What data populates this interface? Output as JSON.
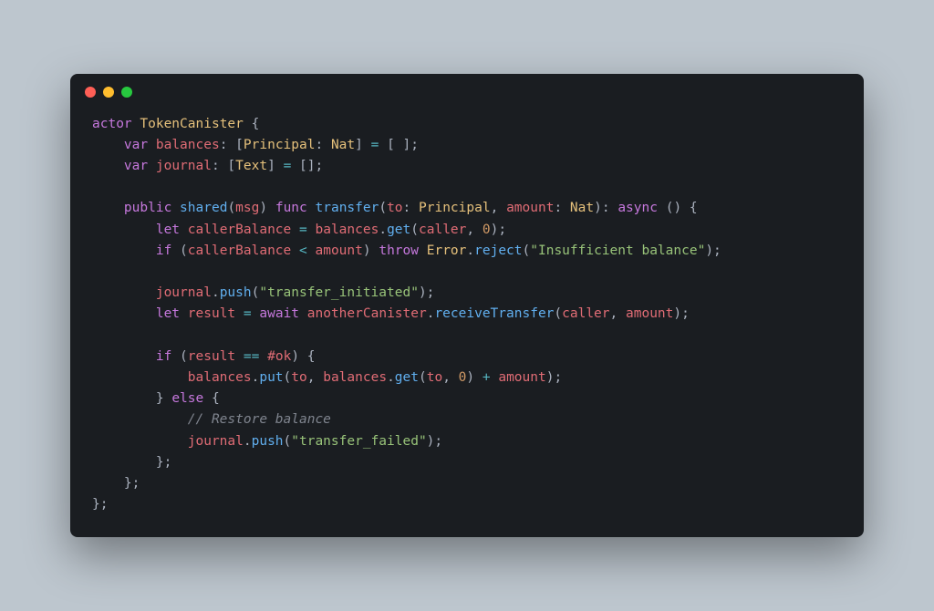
{
  "code": {
    "l1": {
      "kw1": "actor",
      "type1": "TokenCanister",
      "p1": " {"
    },
    "l2": {
      "kw1": "var",
      "id1": "balances",
      "p1": ": [",
      "type1": "Principal",
      "p2": ": ",
      "type2": "Nat",
      "p3": "] ",
      "op1": "=",
      "p4": " [ ];"
    },
    "l3": {
      "kw1": "var",
      "id1": "journal",
      "p1": ": [",
      "type1": "Text",
      "p2": "] ",
      "op1": "=",
      "p3": " [];"
    },
    "l4": {
      "blank": ""
    },
    "l5": {
      "kw1": "public",
      "fn1": "shared",
      "p1": "(",
      "id1": "msg",
      "p2": ") ",
      "kw2": "func",
      "fn2": "transfer",
      "p3": "(",
      "id2": "to",
      "p4": ": ",
      "type1": "Principal",
      "p5": ", ",
      "id3": "amount",
      "p6": ": ",
      "type2": "Nat",
      "p7": "): ",
      "kw3": "async",
      "p8": " () {"
    },
    "l6": {
      "kw1": "let",
      "id1": "callerBalance",
      "op1": "=",
      "id2": "balances",
      "p1": ".",
      "fn1": "get",
      "p2": "(",
      "id3": "caller",
      "p3": ", ",
      "num1": "0",
      "p4": ");"
    },
    "l7": {
      "kw1": "if",
      "p1": " (",
      "id1": "callerBalance",
      "op1": "<",
      "id2": "amount",
      "p2": ") ",
      "kw2": "throw",
      "type1": "Error",
      "p3": ".",
      "fn1": "reject",
      "p4": "(",
      "str1": "\"Insufficient balance\"",
      "p5": ");"
    },
    "l8": {
      "blank": ""
    },
    "l9": {
      "id1": "journal",
      "p1": ".",
      "fn1": "push",
      "p2": "(",
      "str1": "\"transfer_initiated\"",
      "p3": ");"
    },
    "l10": {
      "kw1": "let",
      "id1": "result",
      "op1": "=",
      "kw2": "await",
      "id2": "anotherCanister",
      "p1": ".",
      "fn1": "receiveTransfer",
      "p2": "(",
      "id3": "caller",
      "p3": ", ",
      "id4": "amount",
      "p4": ");"
    },
    "l11": {
      "blank": ""
    },
    "l12": {
      "kw1": "if",
      "p1": " (",
      "id1": "result",
      "op1": "==",
      "id2": "#ok",
      "p2": ") {"
    },
    "l13": {
      "id1": "balances",
      "p1": ".",
      "fn1": "put",
      "p2": "(",
      "id2": "to",
      "p3": ", ",
      "id3": "balances",
      "p4": ".",
      "fn2": "get",
      "p5": "(",
      "id4": "to",
      "p6": ", ",
      "num1": "0",
      "p7": ") ",
      "op1": "+",
      "id5": " amount",
      "p8": ");"
    },
    "l14": {
      "p1": "} ",
      "kw1": "else",
      "p2": " {"
    },
    "l15": {
      "cmt1": "// Restore balance"
    },
    "l16": {
      "id1": "journal",
      "p1": ".",
      "fn1": "push",
      "p2": "(",
      "str1": "\"transfer_failed\"",
      "p3": ");"
    },
    "l17": {
      "p1": "};"
    },
    "l18": {
      "p1": "};"
    },
    "l19": {
      "p1": "};"
    }
  }
}
